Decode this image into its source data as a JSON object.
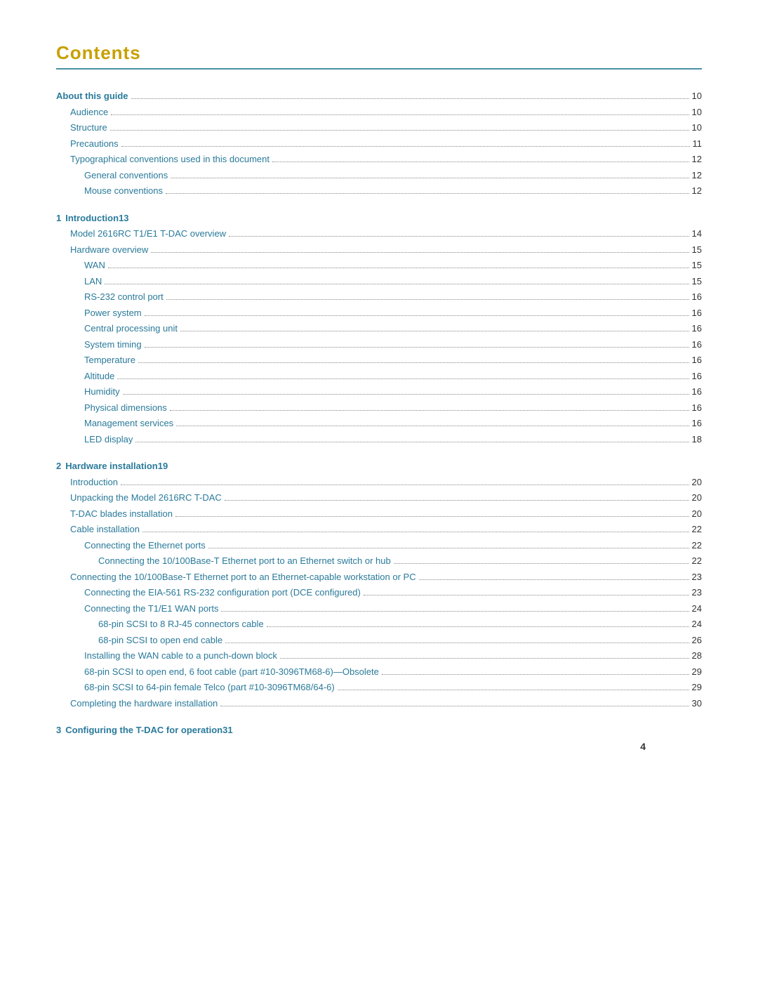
{
  "title": "Contents",
  "footer_page": "4",
  "sections": [
    {
      "group": "preface",
      "items": [
        {
          "label": "About this guide",
          "page": "10",
          "indent": 1,
          "style": "about"
        },
        {
          "label": "Audience",
          "page": "10",
          "indent": 2,
          "style": "sub"
        },
        {
          "label": "Structure",
          "page": "10",
          "indent": 2,
          "style": "sub"
        },
        {
          "label": "Precautions",
          "page": "11",
          "indent": 2,
          "style": "sub"
        },
        {
          "label": "Typographical conventions used in this document",
          "page": "12",
          "indent": 2,
          "style": "sub"
        },
        {
          "label": "General conventions",
          "page": "12",
          "indent": 3,
          "style": "sub"
        },
        {
          "label": "Mouse conventions",
          "page": "12",
          "indent": 3,
          "style": "sub"
        }
      ]
    },
    {
      "group": "chapter",
      "chapter_num": "1",
      "chapter_title": "Introduction",
      "chapter_page": "13",
      "items": [
        {
          "label": "Model 2616RC T1/E1 T-DAC overview",
          "page": "14",
          "indent": 2,
          "style": "sub"
        },
        {
          "label": "Hardware overview",
          "page": "15",
          "indent": 2,
          "style": "sub"
        },
        {
          "label": "WAN",
          "page": "15",
          "indent": 3,
          "style": "sub"
        },
        {
          "label": "LAN",
          "page": "15",
          "indent": 3,
          "style": "sub"
        },
        {
          "label": "RS-232 control port",
          "page": "16",
          "indent": 3,
          "style": "sub"
        },
        {
          "label": "Power system",
          "page": "16",
          "indent": 3,
          "style": "sub"
        },
        {
          "label": "Central processing unit",
          "page": "16",
          "indent": 3,
          "style": "sub"
        },
        {
          "label": "System timing",
          "page": "16",
          "indent": 3,
          "style": "sub"
        },
        {
          "label": "Temperature",
          "page": "16",
          "indent": 3,
          "style": "sub"
        },
        {
          "label": "Altitude",
          "page": "16",
          "indent": 3,
          "style": "sub"
        },
        {
          "label": "Humidity",
          "page": "16",
          "indent": 3,
          "style": "sub"
        },
        {
          "label": "Physical dimensions",
          "page": "16",
          "indent": 3,
          "style": "sub"
        },
        {
          "label": "Management services",
          "page": "16",
          "indent": 3,
          "style": "sub"
        },
        {
          "label": "LED display",
          "page": "18",
          "indent": 3,
          "style": "sub"
        }
      ]
    },
    {
      "group": "chapter",
      "chapter_num": "2",
      "chapter_title": "Hardware installation",
      "chapter_page": "19",
      "items": [
        {
          "label": "Introduction",
          "page": "20",
          "indent": 2,
          "style": "sub"
        },
        {
          "label": "Unpacking the Model 2616RC T-DAC",
          "page": "20",
          "indent": 2,
          "style": "sub"
        },
        {
          "label": "T-DAC blades installation",
          "page": "20",
          "indent": 2,
          "style": "sub"
        },
        {
          "label": "Cable installation",
          "page": "22",
          "indent": 2,
          "style": "sub"
        },
        {
          "label": "Connecting the Ethernet ports",
          "page": "22",
          "indent": 3,
          "style": "sub"
        },
        {
          "label": "Connecting the 10/100Base-T Ethernet port to an Ethernet switch or hub",
          "page": "22",
          "indent": 4,
          "style": "sub"
        },
        {
          "label": "Connecting the 10/100Base-T Ethernet port to an Ethernet-capable workstation or PC",
          "page": "23",
          "indent": 2,
          "style": "sub"
        },
        {
          "label": "Connecting the EIA-561 RS-232 configuration port (DCE configured)",
          "page": "23",
          "indent": 3,
          "style": "sub"
        },
        {
          "label": "Connecting the T1/E1 WAN ports",
          "page": "24",
          "indent": 3,
          "style": "sub"
        },
        {
          "label": "68-pin SCSI to 8 RJ-45 connectors cable",
          "page": "24",
          "indent": 4,
          "style": "sub"
        },
        {
          "label": "68-pin SCSI to open end cable",
          "page": "26",
          "indent": 4,
          "style": "sub"
        },
        {
          "label": "Installing the WAN cable to a punch-down block",
          "page": "28",
          "indent": 3,
          "style": "sub"
        },
        {
          "label": "68-pin SCSI to open end, 6 foot cable (part #10-3096TM68-6)—Obsolete",
          "page": "29",
          "indent": 3,
          "style": "sub"
        },
        {
          "label": "68-pin SCSI to 64-pin female Telco (part #10-3096TM68/64-6)",
          "page": "29",
          "indent": 3,
          "style": "sub"
        },
        {
          "label": "Completing the hardware installation",
          "page": "30",
          "indent": 2,
          "style": "sub"
        }
      ]
    },
    {
      "group": "chapter",
      "chapter_num": "3",
      "chapter_title": "Configuring the T-DAC for operation",
      "chapter_page": "31",
      "items": []
    }
  ]
}
